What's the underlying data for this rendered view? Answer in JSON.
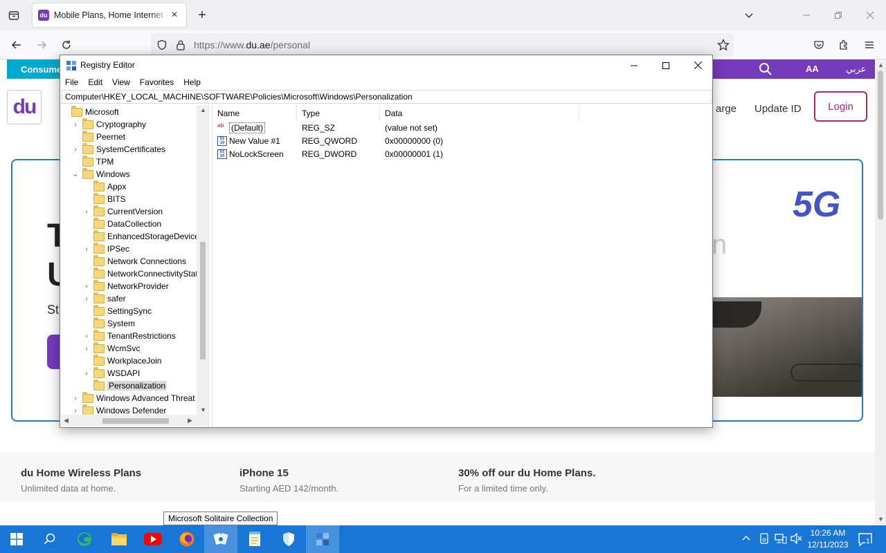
{
  "browser": {
    "tab_title": "Mobile Plans, Home Internet & Broadband",
    "url_prefix": "https://www.",
    "url_domain": "du.ae",
    "url_path": "/personal"
  },
  "website": {
    "strip_left": "Consumer",
    "aa_label": "AA",
    "arabic_label": "عربي",
    "logo_text": "du",
    "nav_recharge": "arge",
    "nav_update_id": "Update ID",
    "login_label": "Login",
    "hero_badge": "5G",
    "hero_line1": "T",
    "hero_line2": "U",
    "hero_sub": "St",
    "hero_ghost": "n",
    "promos": [
      {
        "title": "du Home Wireless Plans",
        "subtitle": "Unlimited data at home."
      },
      {
        "title": "iPhone 15",
        "subtitle": "Starting AED 142/month."
      },
      {
        "title": "30% off our du Home Plans.",
        "subtitle": "For a limited time only."
      }
    ]
  },
  "regedit": {
    "title": "Registry Editor",
    "menu": [
      "File",
      "Edit",
      "View",
      "Favorites",
      "Help"
    ],
    "address": "Computer\\HKEY_LOCAL_MACHINE\\SOFTWARE\\Policies\\Microsoft\\Windows\\Personalization",
    "tree": [
      {
        "label": "Microsoft",
        "expander": "",
        "depth": 0
      },
      {
        "label": "Cryptography",
        "expander": ">",
        "depth": 1
      },
      {
        "label": "Peernet",
        "expander": "",
        "depth": 1
      },
      {
        "label": "SystemCertificates",
        "expander": ">",
        "depth": 1
      },
      {
        "label": "TPM",
        "expander": "",
        "depth": 1
      },
      {
        "label": "Windows",
        "expander": "v",
        "depth": 1
      },
      {
        "label": "Appx",
        "expander": "",
        "depth": 2
      },
      {
        "label": "BITS",
        "expander": "",
        "depth": 2
      },
      {
        "label": "CurrentVersion",
        "expander": ">",
        "depth": 2
      },
      {
        "label": "DataCollection",
        "expander": "",
        "depth": 2
      },
      {
        "label": "EnhancedStorageDevices",
        "expander": "",
        "depth": 2
      },
      {
        "label": "IPSec",
        "expander": ">",
        "depth": 2
      },
      {
        "label": "Network Connections",
        "expander": "",
        "depth": 2
      },
      {
        "label": "NetworkConnectivityStatusI",
        "expander": "",
        "depth": 2
      },
      {
        "label": "NetworkProvider",
        "expander": ">",
        "depth": 2
      },
      {
        "label": "safer",
        "expander": ">",
        "depth": 2
      },
      {
        "label": "SettingSync",
        "expander": "",
        "depth": 2
      },
      {
        "label": "System",
        "expander": "",
        "depth": 2
      },
      {
        "label": "TenantRestrictions",
        "expander": ">",
        "depth": 2
      },
      {
        "label": "WcmSvc",
        "expander": ">",
        "depth": 2
      },
      {
        "label": "WorkplaceJoin",
        "expander": "",
        "depth": 2
      },
      {
        "label": "WSDAPI",
        "expander": ">",
        "depth": 2
      },
      {
        "label": "Personalization",
        "expander": "",
        "depth": 2,
        "selected": true
      },
      {
        "label": "Windows Advanced Threat Pro",
        "expander": ">",
        "depth": 1
      },
      {
        "label": "Windows Defender",
        "expander": ">",
        "depth": 1
      }
    ],
    "columns": [
      "Name",
      "Type",
      "Data"
    ],
    "values": [
      {
        "name": "(Default)",
        "type": "REG_SZ",
        "data": "(value not set)",
        "icon": "string-value-icon"
      },
      {
        "name": "New Value #1",
        "type": "REG_QWORD",
        "data": "0x00000000 (0)",
        "icon": "binary-value-icon"
      },
      {
        "name": "NoLockScreen",
        "type": "REG_DWORD",
        "data": "0x00000001 (1)",
        "icon": "binary-value-icon"
      }
    ]
  },
  "tooltip": "Microsoft Solitaire Collection",
  "taskbar": {
    "time": "10:26 AM",
    "date": "12/11/2023",
    "notification_count": "1"
  },
  "colors": {
    "du_purple": "#753bbd",
    "du_magenta": "#b0247f",
    "taskbar_blue": "#1877d4",
    "hero_border": "#1f7fc5"
  }
}
